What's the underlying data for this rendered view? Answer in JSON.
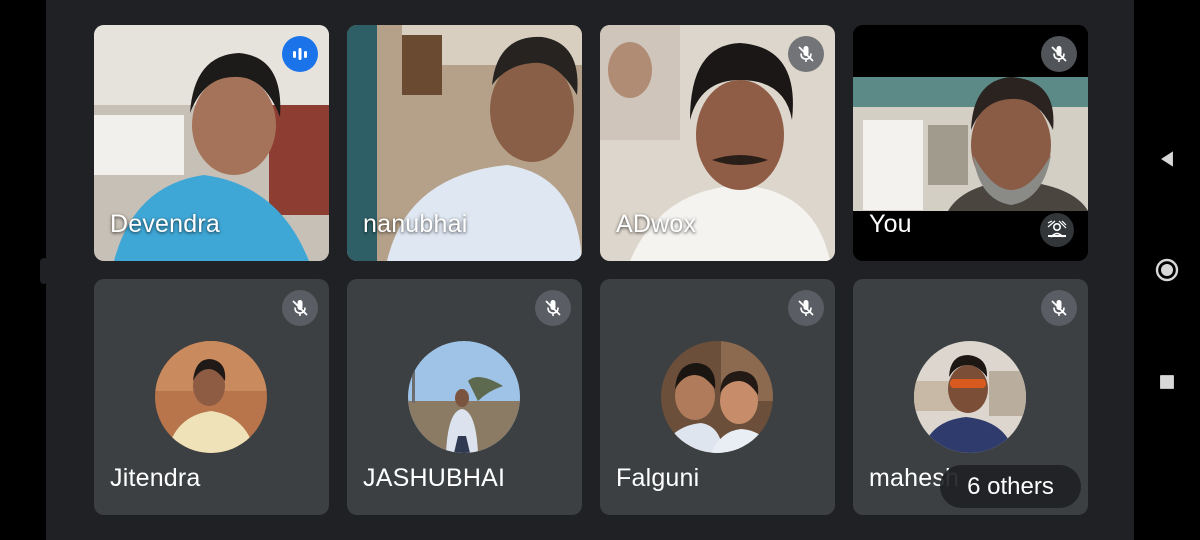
{
  "meeting": {
    "participants": [
      {
        "name": "Devendra",
        "mic": "speaking"
      },
      {
        "name": "nanubhai",
        "mic": "none"
      },
      {
        "name": "ADwox",
        "mic": "muted"
      },
      {
        "name": "You",
        "mic": "muted"
      },
      {
        "name": "Jitendra",
        "mic": "muted"
      },
      {
        "name": "JASHUBHAI",
        "mic": "muted"
      },
      {
        "name": "Falguni",
        "mic": "muted"
      },
      {
        "name": "mahesh",
        "mic": "muted"
      }
    ],
    "others_label": "6 others"
  },
  "icons": {
    "speaking": "audio-level-icon",
    "muted": "mic-off-icon",
    "effects": "background-effects-icon",
    "nav": [
      "back-icon",
      "home-icon",
      "recents-icon"
    ]
  },
  "colors": {
    "background": "#202124",
    "tile": "#3c4043",
    "speaking_blue": "#1a73e8",
    "badge_gray": "#5f6368"
  }
}
